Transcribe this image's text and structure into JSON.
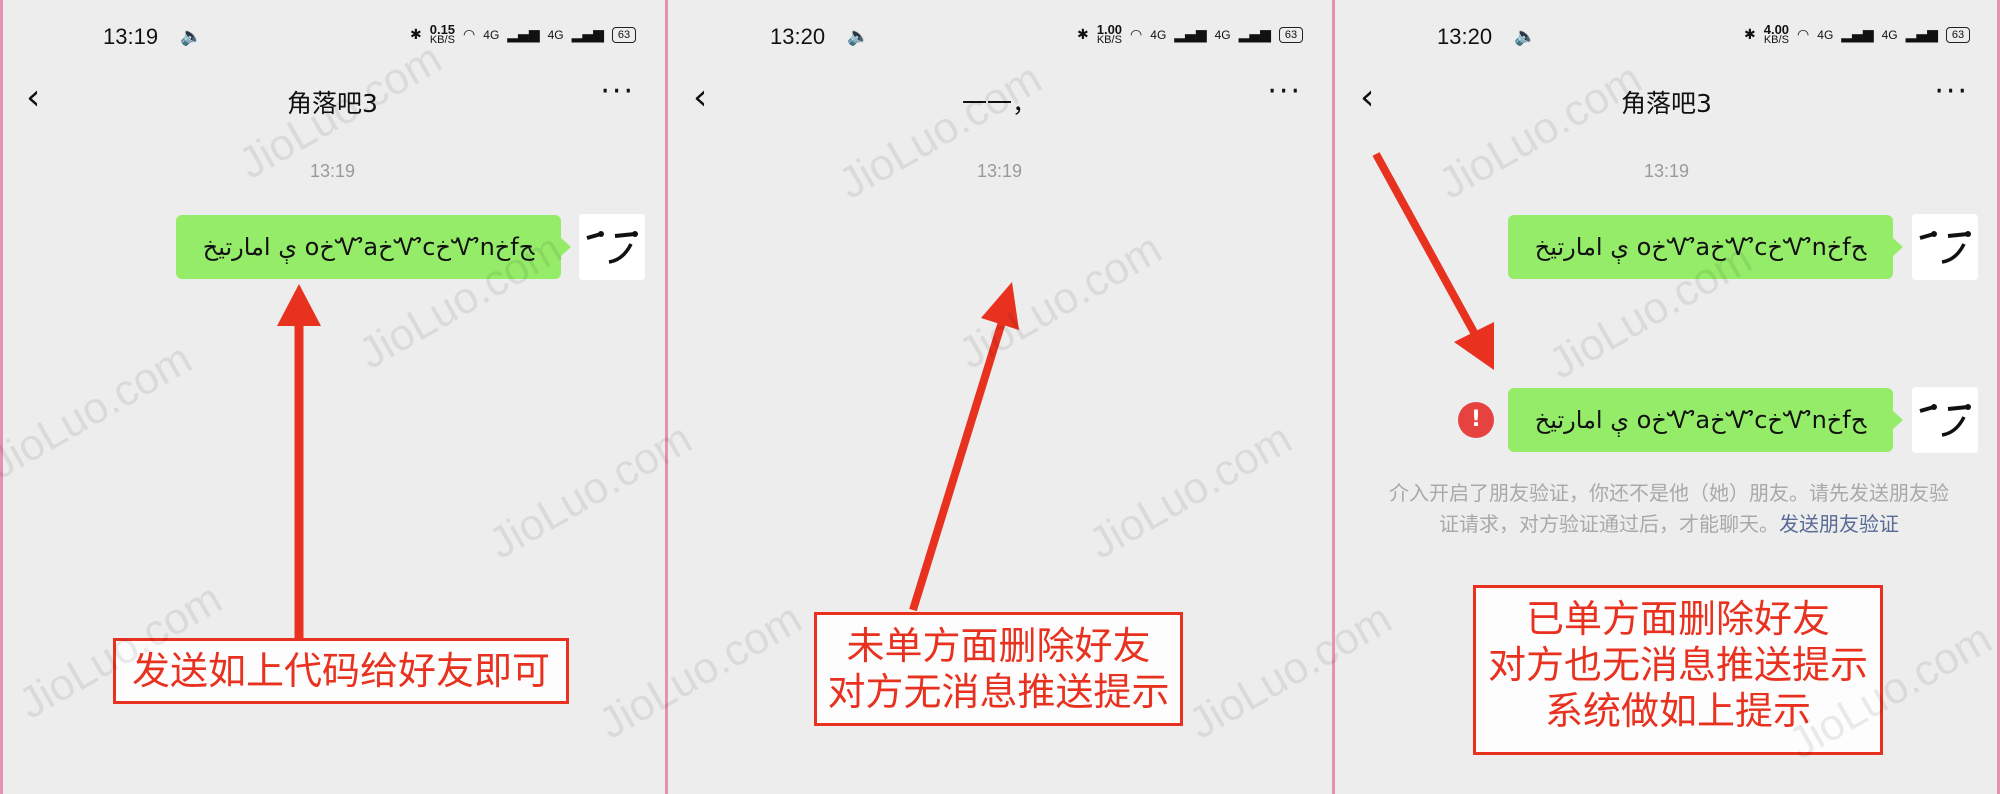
{
  "colors": {
    "bubble": "#95ec69",
    "background": "#ededed",
    "annotation_red": "#e8311f",
    "error_red": "#e64340",
    "link_blue": "#576b95",
    "divider_pink": "#e98fb4"
  },
  "screens": [
    {
      "status": {
        "time": "13:19",
        "speed_value": "0.15",
        "speed_unit": "KB/S",
        "net1": "4G",
        "net2": "4G",
        "battery": "63"
      },
      "nav": {
        "title": "角落吧3"
      },
      "timestamp": "13:19",
      "message": "ﯤ امارتيخ oخᏉaخᏉcخᏉnخfﺢ",
      "callout": "发送如上代码给好友即可"
    },
    {
      "status": {
        "time": "13:20",
        "speed_value": "1.00",
        "speed_unit": "KB/S",
        "net1": "4G",
        "net2": "4G",
        "battery": "63"
      },
      "nav": {
        "title": "一一，"
      },
      "timestamp": "13:19",
      "callout_line1": "未单方面删除好友",
      "callout_line2": "对方无消息推送提示"
    },
    {
      "status": {
        "time": "13:20",
        "speed_value": "4.00",
        "speed_unit": "KB/S",
        "net1": "4G",
        "net2": "4G",
        "battery": "63"
      },
      "nav": {
        "title": "角落吧3"
      },
      "timestamp": "13:19",
      "message1": "ﯤ امارتيخ oخᏉaخᏉcخᏉnخfﺢ",
      "message2": "ﯤ امارتيخ oخᏉaخᏉcخᏉnخfﺢ",
      "error_mark": "!",
      "system_note_text": "介入开启了朋友验证，你还不是他（她）朋友。请先发送朋友验证请求，对方验证通过后，才能聊天。",
      "system_note_link": "发送朋友验证",
      "callout_line1": "已单方面删除好友",
      "callout_line2": "对方也无消息推送提示",
      "callout_line3": "系统做如上提示"
    }
  ],
  "watermark": "JioLuo.com"
}
